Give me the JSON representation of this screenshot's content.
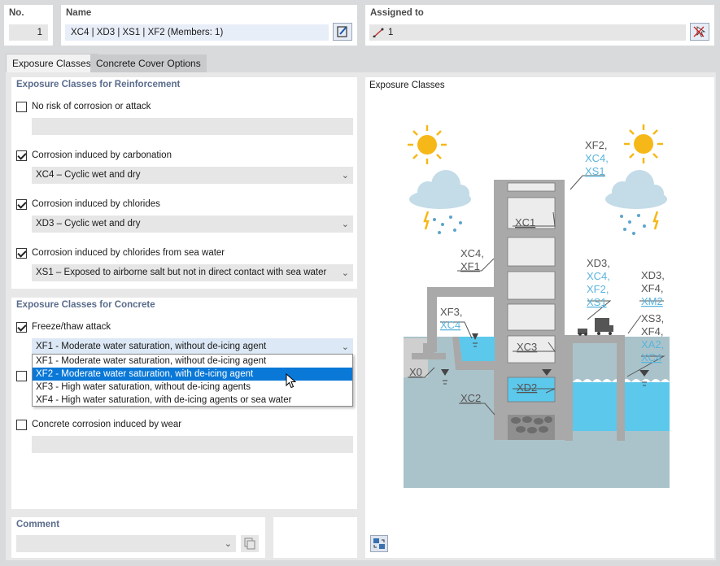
{
  "header": {
    "no_label": "No.",
    "no_value": "1",
    "name_label": "Name",
    "name_value": "XC4 | XD3 | XS1 | XF2 (Members: 1)",
    "assigned_label": "Assigned to",
    "assigned_value": "1"
  },
  "tabs": [
    {
      "label": "Exposure Classes",
      "active": true
    },
    {
      "label": "Concrete Cover Options",
      "active": false
    }
  ],
  "reinforcement": {
    "title": "Exposure Classes for Reinforcement",
    "items": [
      {
        "label": "No risk of corrosion or attack",
        "checked": false,
        "value": ""
      },
      {
        "label": "Corrosion induced by carbonation",
        "checked": true,
        "value": "XC4 – Cyclic wet and dry"
      },
      {
        "label": "Corrosion induced by chlorides",
        "checked": true,
        "value": "XD3 – Cyclic wet and dry"
      },
      {
        "label": "Corrosion induced by chlorides from sea water",
        "checked": true,
        "value": "XS1 – Exposed to airborne salt but not in direct contact with sea water"
      }
    ]
  },
  "concrete": {
    "title": "Exposure Classes for Concrete",
    "freeze_label": "Freeze/thaw attack",
    "freeze_checked": true,
    "freeze_value": "XF1 - Moderate water saturation, without de-icing agent",
    "freeze_options": [
      "XF1 - Moderate water saturation, without de-icing agent",
      "XF2 - Moderate water saturation, with de-icing agent",
      "XF3 - High water saturation, without de-icing agents",
      "XF4 - High water saturation, with de-icing agents or sea water"
    ],
    "freeze_highlighted": 1,
    "wear_label": "Concrete corrosion induced by wear",
    "wear_checked": false
  },
  "comment": {
    "label": "Comment",
    "value": ""
  },
  "diagram": {
    "title": "Exposure Classes",
    "labels": {
      "top_right_1": "XF2,",
      "top_right_2": "XC4,",
      "top_right_3": "XS1",
      "xc1": "XC1",
      "left_1": "XC4,",
      "left_2": "XF1",
      "mid_1": "XD3,",
      "mid_2": "XC4,",
      "mid_3": "XF2,",
      "mid_4": "XS1",
      "right_1": "XD3,",
      "right_2": "XF4,",
      "right_3": "XM2",
      "xf3": "XF3,",
      "xc4b": "XC4",
      "xc3": "XC3",
      "r2_1": "XS3,",
      "r2_2": "XF4,",
      "r2_3": "XA2,",
      "r2_4": "XC4",
      "x0": "X0",
      "xd2": "XD2",
      "xc2": "XC2"
    }
  },
  "colors": {
    "accent": "#0a78d7",
    "highlight_label": "#5ab4dc",
    "water": "#aac9d3",
    "water_blue": "#5cc8ec"
  }
}
